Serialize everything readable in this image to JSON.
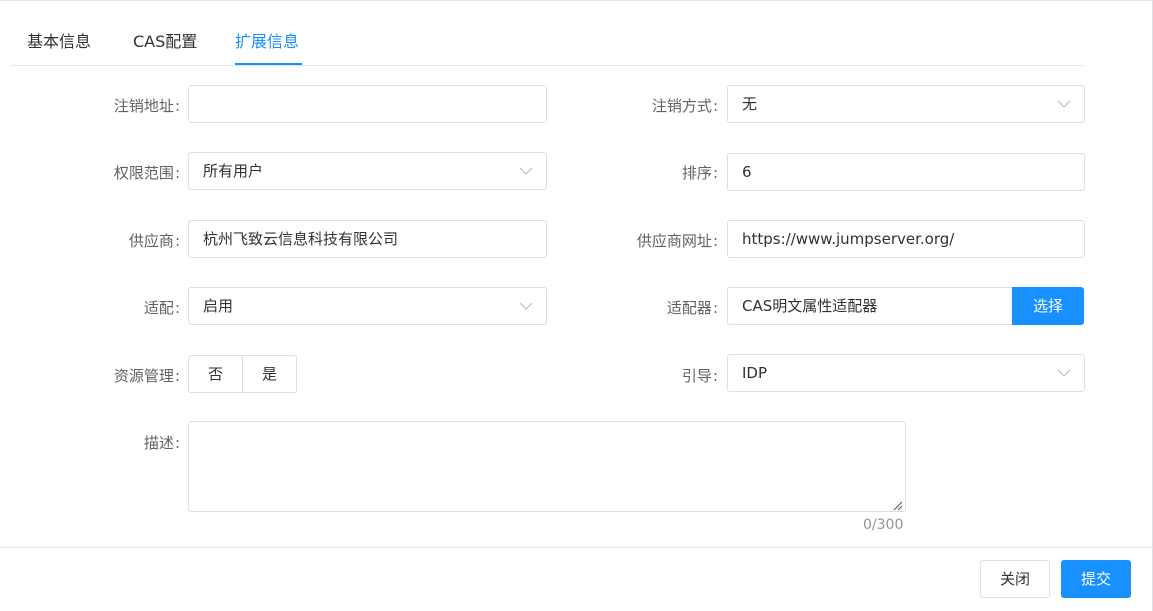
{
  "tabs": [
    {
      "label": "基本信息",
      "active": false
    },
    {
      "label": "CAS配置",
      "active": false
    },
    {
      "label": "扩展信息",
      "active": true
    }
  ],
  "form": {
    "logout_url": {
      "label": "注销地址",
      "value": ""
    },
    "logout_method": {
      "label": "注销方式",
      "value": "无"
    },
    "permission_scope": {
      "label": "权限范围",
      "value": "所有用户"
    },
    "sort": {
      "label": "排序",
      "value": "6"
    },
    "vendor": {
      "label": "供应商",
      "value": "杭州飞致云信息科技有限公司"
    },
    "vendor_url": {
      "label": "供应商网址",
      "value": "https://www.jumpserver.org/"
    },
    "adapt": {
      "label": "适配",
      "value": "启用"
    },
    "adapter": {
      "label": "适配器",
      "value": "CAS明文属性适配器",
      "button": "选择"
    },
    "resource_mgmt": {
      "label": "资源管理",
      "options": [
        "否",
        "是"
      ]
    },
    "guide": {
      "label": "引导",
      "value": "IDP"
    },
    "description": {
      "label": "描述",
      "value": "",
      "counter": "0/300"
    }
  },
  "colon": ":",
  "footer": {
    "close": "关闭",
    "submit": "提交"
  },
  "colors": {
    "primary": "#1890ff",
    "border": "#dcdfe6"
  }
}
